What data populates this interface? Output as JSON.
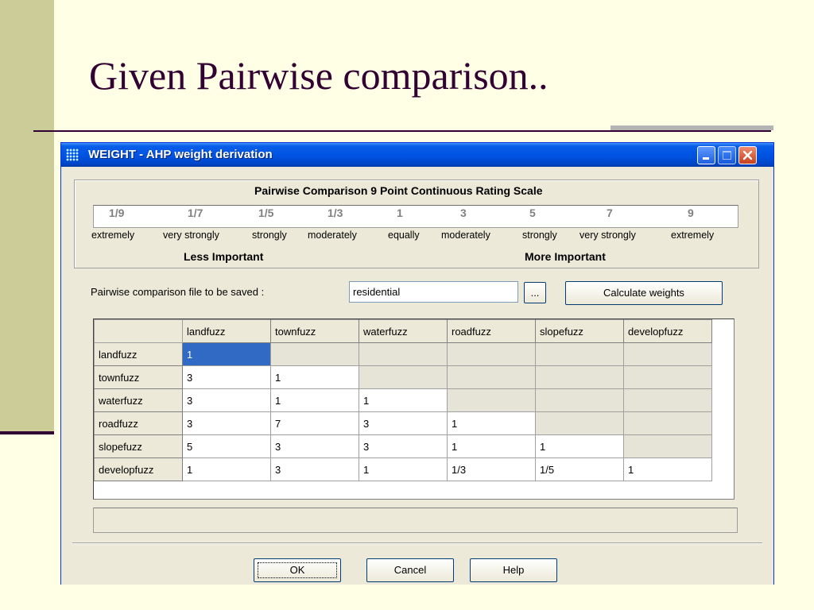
{
  "slide": {
    "title": "Given Pairwise comparison.."
  },
  "window": {
    "title": "WEIGHT - AHP weight derivation",
    "title_bar_color": "#0054e3",
    "icons": [
      "grid-app-icon",
      "minimize-icon",
      "maximize-icon",
      "close-icon"
    ]
  },
  "scale": {
    "legend": "Pairwise Comparison 9 Point Continuous Rating Scale",
    "values": [
      "1/9",
      "1/7",
      "1/5",
      "1/3",
      "1",
      "3",
      "5",
      "7",
      "9"
    ],
    "descriptions": [
      "extremely",
      "very strongly",
      "strongly",
      "moderately",
      "equally",
      "moderately",
      "strongly",
      "very strongly",
      "extremely"
    ],
    "less_label": "Less Important",
    "more_label": "More Important"
  },
  "file": {
    "label": "Pairwise comparison file to be saved :",
    "value": "residential",
    "browse_label": "...",
    "calculate_label": "Calculate weights"
  },
  "grid": {
    "columns": [
      "landfuzz",
      "townfuzz",
      "waterfuzz",
      "roadfuzz",
      "slopefuzz",
      "developfuzz"
    ],
    "rows": [
      {
        "label": "landfuzz",
        "cells": [
          "1",
          "",
          "",
          "",
          "",
          ""
        ]
      },
      {
        "label": "townfuzz",
        "cells": [
          "3",
          "1",
          "",
          "",
          "",
          ""
        ]
      },
      {
        "label": "waterfuzz",
        "cells": [
          "3",
          "1",
          "1",
          "",
          "",
          ""
        ]
      },
      {
        "label": "roadfuzz",
        "cells": [
          "3",
          "7",
          "3",
          "1",
          "",
          ""
        ]
      },
      {
        "label": "slopefuzz",
        "cells": [
          "5",
          "3",
          "3",
          "1",
          "1",
          ""
        ]
      },
      {
        "label": "developfuzz",
        "cells": [
          "1",
          "3",
          "1",
          "1/3",
          "1/5",
          "1"
        ]
      }
    ],
    "selected_color": "#316ac5"
  },
  "buttons": {
    "ok": "OK",
    "cancel": "Cancel",
    "help": "Help"
  }
}
